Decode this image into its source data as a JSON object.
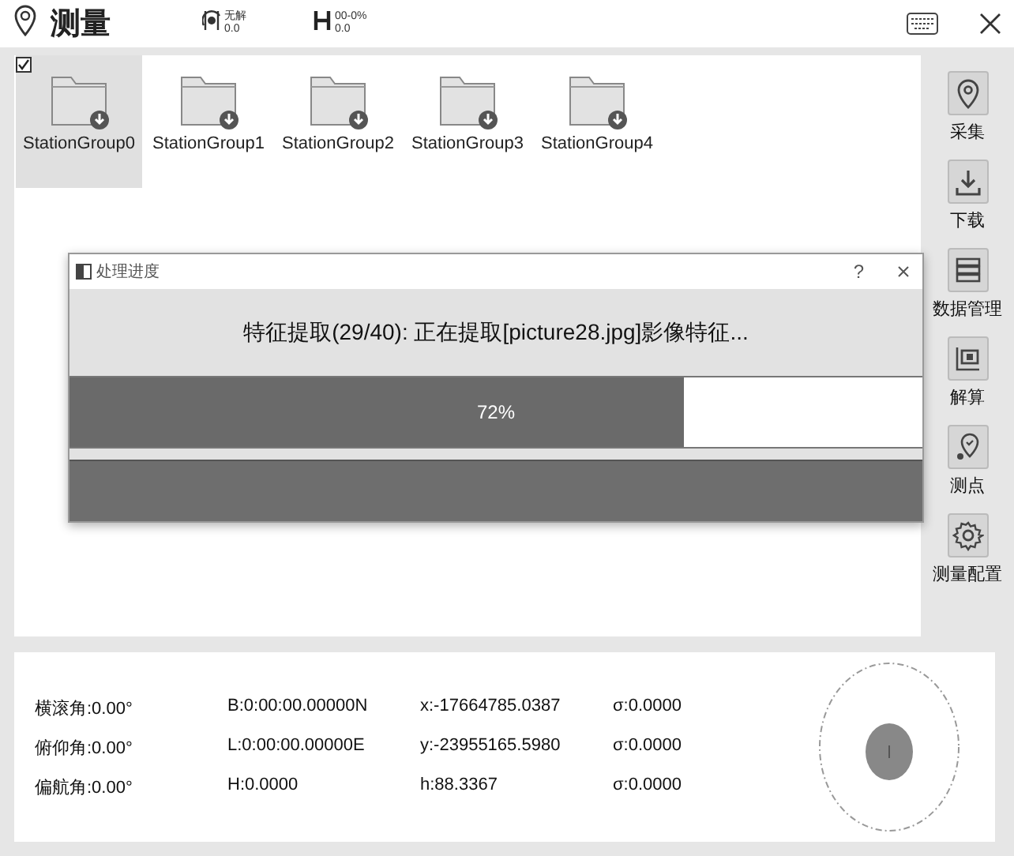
{
  "window": {
    "title": "测量"
  },
  "status": [
    {
      "kind": "satellite",
      "label": "无解",
      "value": "0.0"
    },
    {
      "kind": "height",
      "label": "00-0%",
      "value": "0.0"
    }
  ],
  "select_all": {
    "checked": true
  },
  "groups": [
    {
      "name": "StationGroup0",
      "selected": true
    },
    {
      "name": "StationGroup1",
      "selected": false
    },
    {
      "name": "StationGroup2",
      "selected": false
    },
    {
      "name": "StationGroup3",
      "selected": false
    },
    {
      "name": "StationGroup4",
      "selected": false
    }
  ],
  "tools": [
    {
      "kind": "collect",
      "label": "采集"
    },
    {
      "kind": "download",
      "label": "下载"
    },
    {
      "kind": "data",
      "label": "数据管理"
    },
    {
      "kind": "solve",
      "label": "解算"
    },
    {
      "kind": "point",
      "label": "测点"
    },
    {
      "kind": "settings",
      "label": "测量配置"
    }
  ],
  "dialog": {
    "title": "处理进度",
    "help": "?",
    "message": "特征提取(29/40): 正在提取[picture28.jpg]影像特征...",
    "level": 0.72,
    "reading": "72%"
  },
  "readings": [
    [
      "横滚角:0.00°",
      "B:0:00:00.00000N",
      "x:-17664785.0387",
      "σ:0.0000"
    ],
    [
      "俯仰角:0.00°",
      "L:0:00:00.00000E",
      "y:-23955165.5980",
      "σ:0.0000"
    ],
    [
      "偏航角:0.00°",
      "H:0.0000",
      "h:88.3367",
      "σ:0.0000"
    ]
  ]
}
